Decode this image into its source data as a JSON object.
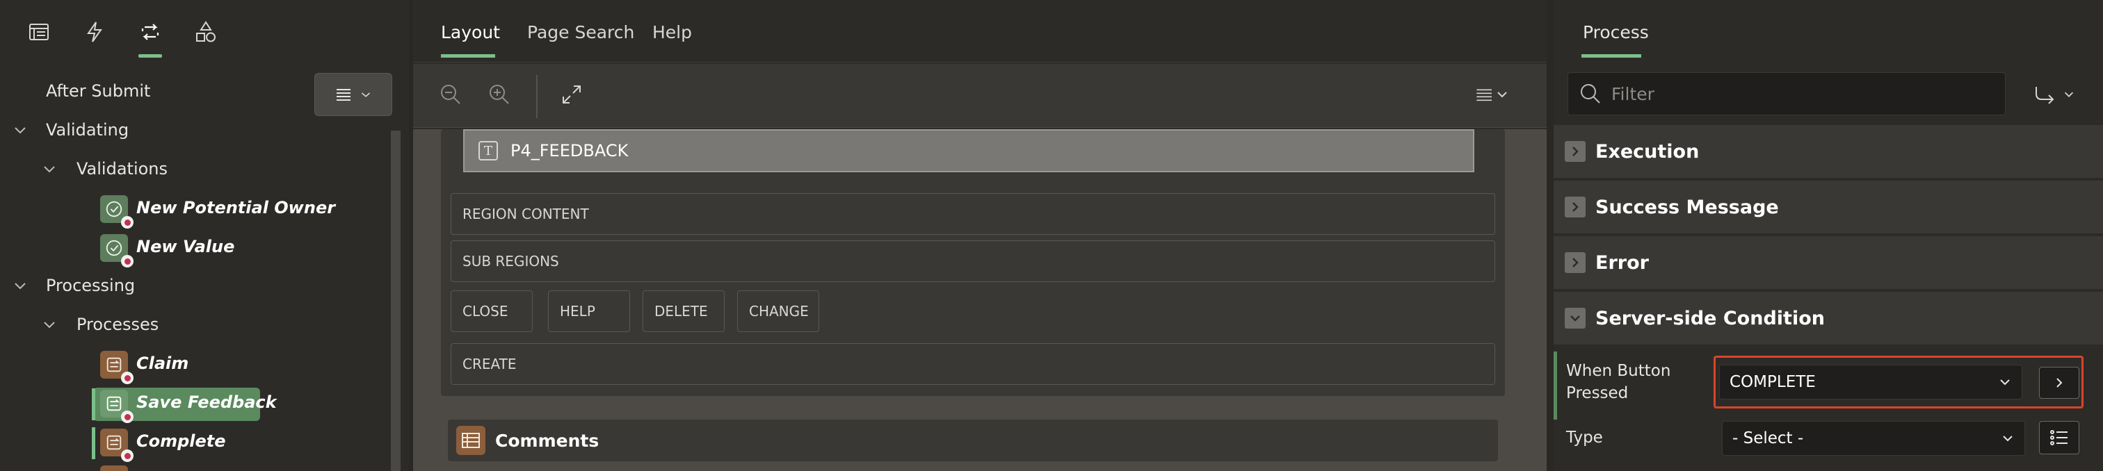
{
  "left": {
    "toolbar_icons": [
      "rendering-icon",
      "dynamic-actions-icon",
      "processing-icon",
      "shared-components-icon"
    ],
    "tree": {
      "after_submit": "After Submit",
      "validating": "Validating",
      "validations": "Validations",
      "validation_items": [
        "New Potential Owner",
        "New Value"
      ],
      "processing": "Processing",
      "processes": "Processes",
      "process_items": [
        "Claim",
        "Save Feedback",
        "Complete"
      ]
    }
  },
  "middle": {
    "tabs": [
      "Layout",
      "Page Search",
      "Help"
    ],
    "active_tab": "Layout",
    "item": "P4_FEEDBACK",
    "slots": {
      "region_content": "REGION CONTENT",
      "sub_regions": "SUB REGIONS",
      "buttons": [
        "CLOSE",
        "HELP",
        "DELETE",
        "CHANGE"
      ],
      "create": "CREATE"
    },
    "comments": "Comments"
  },
  "right": {
    "tab": "Process",
    "filter_placeholder": "Filter",
    "sections": [
      "Execution",
      "Success Message",
      "Error",
      "Server-side Condition"
    ],
    "when_button_pressed_label_1": "When Button",
    "when_button_pressed_label_2": "Pressed",
    "when_button_pressed_value": "COMPLETE",
    "type_label": "Type",
    "type_value": "- Select -"
  },
  "colors": {
    "accent_green": "#7bbf8a",
    "highlight_red": "#d9442a",
    "validation_icon_bg": "#5e7d5c",
    "process_icon_bg": "#8b5e3c",
    "selected_bg": "#5a8a5e"
  }
}
